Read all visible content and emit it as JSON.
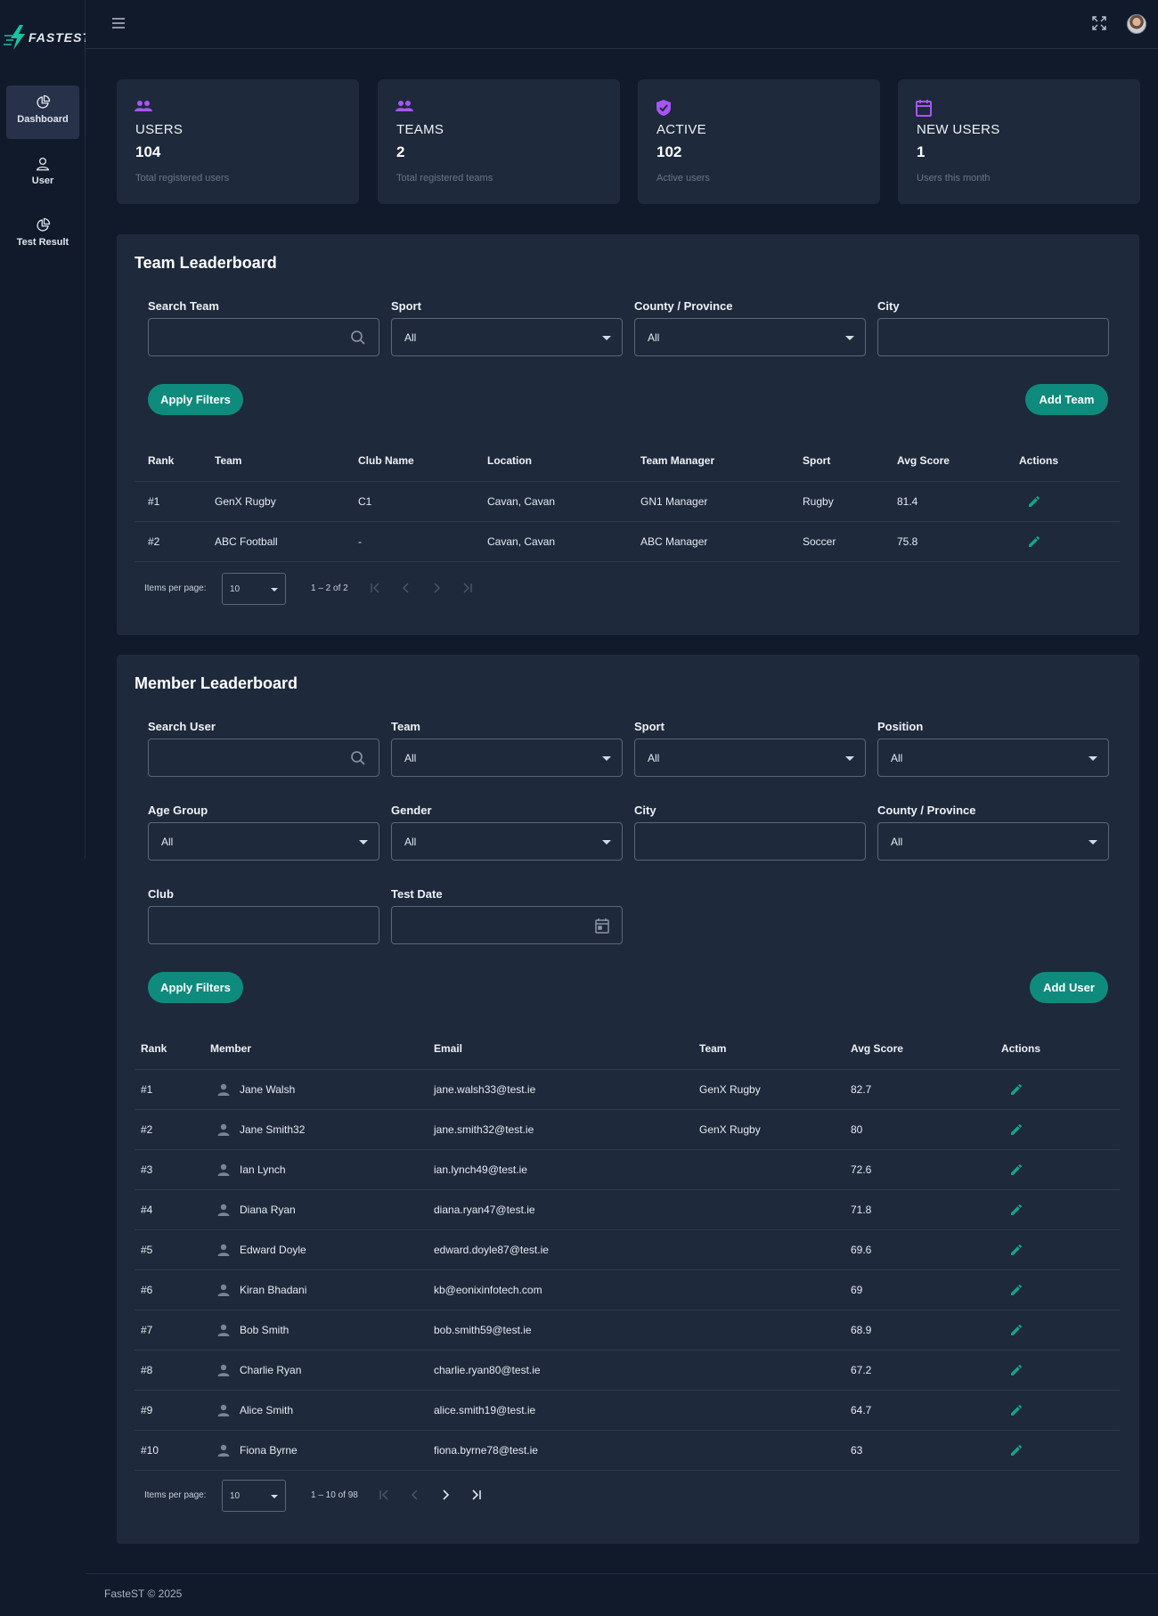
{
  "app": {
    "logo_text": "FASTEST",
    "footer": "FasteST © 2025"
  },
  "sidebar": {
    "items": [
      {
        "label": "Dashboard",
        "icon": "chart-pie-icon",
        "active": true
      },
      {
        "label": "User",
        "icon": "user-icon",
        "active": false
      },
      {
        "label": "Test Result",
        "icon": "chart-pie-icon",
        "active": false
      }
    ]
  },
  "colors": {
    "accent": "#0f8b7d",
    "icon_purple": "#a855f7",
    "card_bg": "#1e293b",
    "page_bg": "#111a2b"
  },
  "stats": [
    {
      "label": "USERS",
      "value": "104",
      "desc": "Total registered users",
      "icon": "users-icon"
    },
    {
      "label": "TEAMS",
      "value": "2",
      "desc": "Total registered teams",
      "icon": "users-icon"
    },
    {
      "label": "ACTIVE",
      "value": "102",
      "desc": "Active users",
      "icon": "shield-check-icon"
    },
    {
      "label": "NEW USERS",
      "value": "1",
      "desc": "Users this month",
      "icon": "calendar-icon"
    }
  ],
  "team_board": {
    "title": "Team Leaderboard",
    "filters": {
      "search_label": "Search Team",
      "search_value": "",
      "sport_label": "Sport",
      "sport_value": "All",
      "county_label": "County / Province",
      "county_value": "All",
      "city_label": "City",
      "city_value": ""
    },
    "apply_label": "Apply Filters",
    "add_label": "Add Team",
    "columns": [
      "Rank",
      "Team",
      "Club Name",
      "Location",
      "Team Manager",
      "Sport",
      "Avg Score",
      "Actions"
    ],
    "rows": [
      {
        "rank": "#1",
        "team": "GenX Rugby",
        "club": "C1",
        "location": "Cavan, Cavan",
        "manager": "GN1 Manager",
        "sport": "Rugby",
        "avg": "81.4"
      },
      {
        "rank": "#2",
        "team": "ABC Football",
        "club": "-",
        "location": "Cavan, Cavan",
        "manager": "ABC Manager",
        "sport": "Soccer",
        "avg": "75.8"
      }
    ],
    "pager": {
      "ipp_label": "Items per page:",
      "ipp_value": "10",
      "range": "1 – 2 of 2"
    }
  },
  "member_board": {
    "title": "Member Leaderboard",
    "filters": {
      "search_label": "Search User",
      "search_value": "",
      "team_label": "Team",
      "team_value": "All",
      "sport_label": "Sport",
      "sport_value": "All",
      "position_label": "Position",
      "position_value": "All",
      "age_label": "Age Group",
      "age_value": "All",
      "gender_label": "Gender",
      "gender_value": "All",
      "city_label": "City",
      "city_value": "",
      "county_label": "County / Province",
      "county_value": "All",
      "club_label": "Club",
      "club_value": "",
      "date_label": "Test Date",
      "date_value": ""
    },
    "apply_label": "Apply Filters",
    "add_label": "Add User",
    "columns": [
      "Rank",
      "Member",
      "Email",
      "Team",
      "Avg Score",
      "Actions"
    ],
    "rows": [
      {
        "rank": "#1",
        "member": "Jane Walsh",
        "email": "jane.walsh33@test.ie",
        "team": "GenX Rugby",
        "avg": "82.7"
      },
      {
        "rank": "#2",
        "member": "Jane Smith32",
        "email": "jane.smith32@test.ie",
        "team": "GenX Rugby",
        "avg": "80"
      },
      {
        "rank": "#3",
        "member": "Ian Lynch",
        "email": "ian.lynch49@test.ie",
        "team": "",
        "avg": "72.6"
      },
      {
        "rank": "#4",
        "member": "Diana Ryan",
        "email": "diana.ryan47@test.ie",
        "team": "",
        "avg": "71.8"
      },
      {
        "rank": "#5",
        "member": "Edward Doyle",
        "email": "edward.doyle87@test.ie",
        "team": "",
        "avg": "69.6"
      },
      {
        "rank": "#6",
        "member": "Kiran Bhadani",
        "email": "kb@eonixinfotech.com",
        "team": "",
        "avg": "69"
      },
      {
        "rank": "#7",
        "member": "Bob Smith",
        "email": "bob.smith59@test.ie",
        "team": "",
        "avg": "68.9"
      },
      {
        "rank": "#8",
        "member": "Charlie Ryan",
        "email": "charlie.ryan80@test.ie",
        "team": "",
        "avg": "67.2"
      },
      {
        "rank": "#9",
        "member": "Alice Smith",
        "email": "alice.smith19@test.ie",
        "team": "",
        "avg": "64.7"
      },
      {
        "rank": "#10",
        "member": "Fiona Byrne",
        "email": "fiona.byrne78@test.ie",
        "team": "",
        "avg": "63"
      }
    ],
    "pager": {
      "ipp_label": "Items per page:",
      "ipp_value": "10",
      "range": "1 – 10 of 98"
    }
  }
}
